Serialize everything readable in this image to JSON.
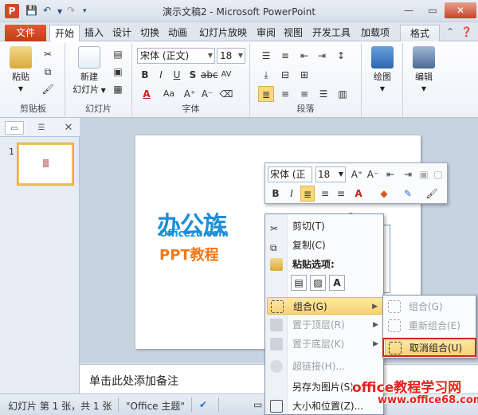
{
  "window": {
    "title": "演示文稿2 - Microsoft PowerPoint",
    "app_icon": "P",
    "quick_access": [
      "save-icon",
      "undo-icon",
      "redo-icon",
      "customize-icon"
    ],
    "controls": [
      "help-icon",
      "minimize",
      "maximize",
      "close"
    ]
  },
  "tabs": {
    "file": "文件",
    "items": [
      "开始",
      "插入",
      "设计",
      "切换",
      "动画",
      "幻灯片放映",
      "审阅",
      "视图",
      "开发工具",
      "加载项"
    ],
    "active": "开始",
    "context_tab": "格式"
  },
  "ribbon": {
    "clipboard": {
      "paste": "粘贴",
      "label": "剪贴板"
    },
    "slides": {
      "new_slide": "新建",
      "new_slide2": "幻灯片",
      "label": "幻灯片"
    },
    "font": {
      "font_name": "宋体 (正文)",
      "font_size": "18",
      "label": "字体"
    },
    "paragraph": {
      "label": "段落"
    },
    "drawing": {
      "label": "绘图"
    },
    "editing": {
      "label": "编辑"
    }
  },
  "slide_panel": {
    "slide_number": "1"
  },
  "slide": {
    "logo_text": "办公族",
    "logo_url": "Officezu.com",
    "logo_tag": "PPT教程"
  },
  "mini_toolbar": {
    "font_name": "宋体 (正3",
    "font_size": "18"
  },
  "context_menu": {
    "items": [
      {
        "label": "剪切(T)",
        "icon": "scissors-icon",
        "disabled": false
      },
      {
        "label": "复制(C)",
        "icon": "copy-icon",
        "disabled": false
      },
      {
        "label": "粘贴选项:",
        "icon": "paste-icon",
        "disabled": false
      },
      {
        "label": "组合(G)",
        "icon": "group-icon",
        "disabled": false,
        "highlighted": true
      },
      {
        "label": "置于顶层(R)",
        "icon": "bring-front-icon",
        "disabled": true
      },
      {
        "label": "置于底层(K)",
        "icon": "send-back-icon",
        "disabled": true
      },
      {
        "label": "超链接(H)...",
        "icon": "hyperlink-icon",
        "disabled": true
      },
      {
        "label": "另存为图片(S)...",
        "icon": "",
        "disabled": false
      },
      {
        "label": "大小和位置(Z)...",
        "icon": "size-icon",
        "disabled": false
      }
    ]
  },
  "submenu": {
    "items": [
      {
        "label": "组合(G)",
        "disabled": true
      },
      {
        "label": "重新组合(E)",
        "disabled": true
      },
      {
        "label": "取消组合(U)",
        "disabled": false,
        "highlighted": true
      }
    ]
  },
  "notes": {
    "placeholder": "单击此处添加备注"
  },
  "status": {
    "slide_info": "幻灯片 第 1 张，共 1 张",
    "theme": "\"Office 主题\""
  },
  "watermark": {
    "line1": "office教程学习网",
    "line2": "www.office68.com"
  }
}
